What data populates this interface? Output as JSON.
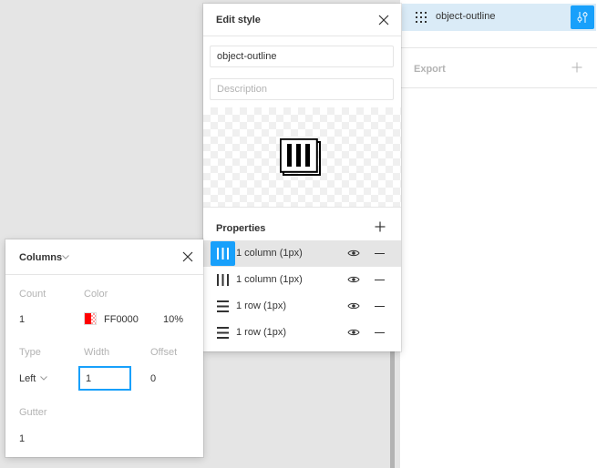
{
  "right_panel": {
    "style_name": "object-outline",
    "icons": {
      "grid": "grid-dots-icon",
      "adjust": "adjust-sliders-icon"
    },
    "export_label": "Export",
    "export_add_icon": "plus-icon"
  },
  "edit_style": {
    "title": "Edit style",
    "name_value": "object-outline",
    "description_placeholder": "Description",
    "properties_title": "Properties",
    "properties": [
      {
        "label": "1 column (1px)",
        "icon": "columns-icon",
        "selected": true
      },
      {
        "label": "1 column (1px)",
        "icon": "columns-icon",
        "selected": false
      },
      {
        "label": "1 row (1px)",
        "icon": "rows-icon",
        "selected": false
      },
      {
        "label": "1 row (1px)",
        "icon": "rows-icon",
        "selected": false
      }
    ]
  },
  "columns": {
    "title": "Columns",
    "count_label": "Count",
    "count_value": "1",
    "color_label": "Color",
    "color_hex": "FF0000",
    "color_opacity": "10%",
    "type_label": "Type",
    "type_value": "Left",
    "width_label": "Width",
    "width_value": "1",
    "offset_label": "Offset",
    "offset_value": "0",
    "gutter_label": "Gutter",
    "gutter_value": "1"
  },
  "colors": {
    "accent": "#18a0fb",
    "swatch": "#ff0000",
    "selected_row": "#e5e5e5",
    "style_row_bg": "#daebf7"
  }
}
